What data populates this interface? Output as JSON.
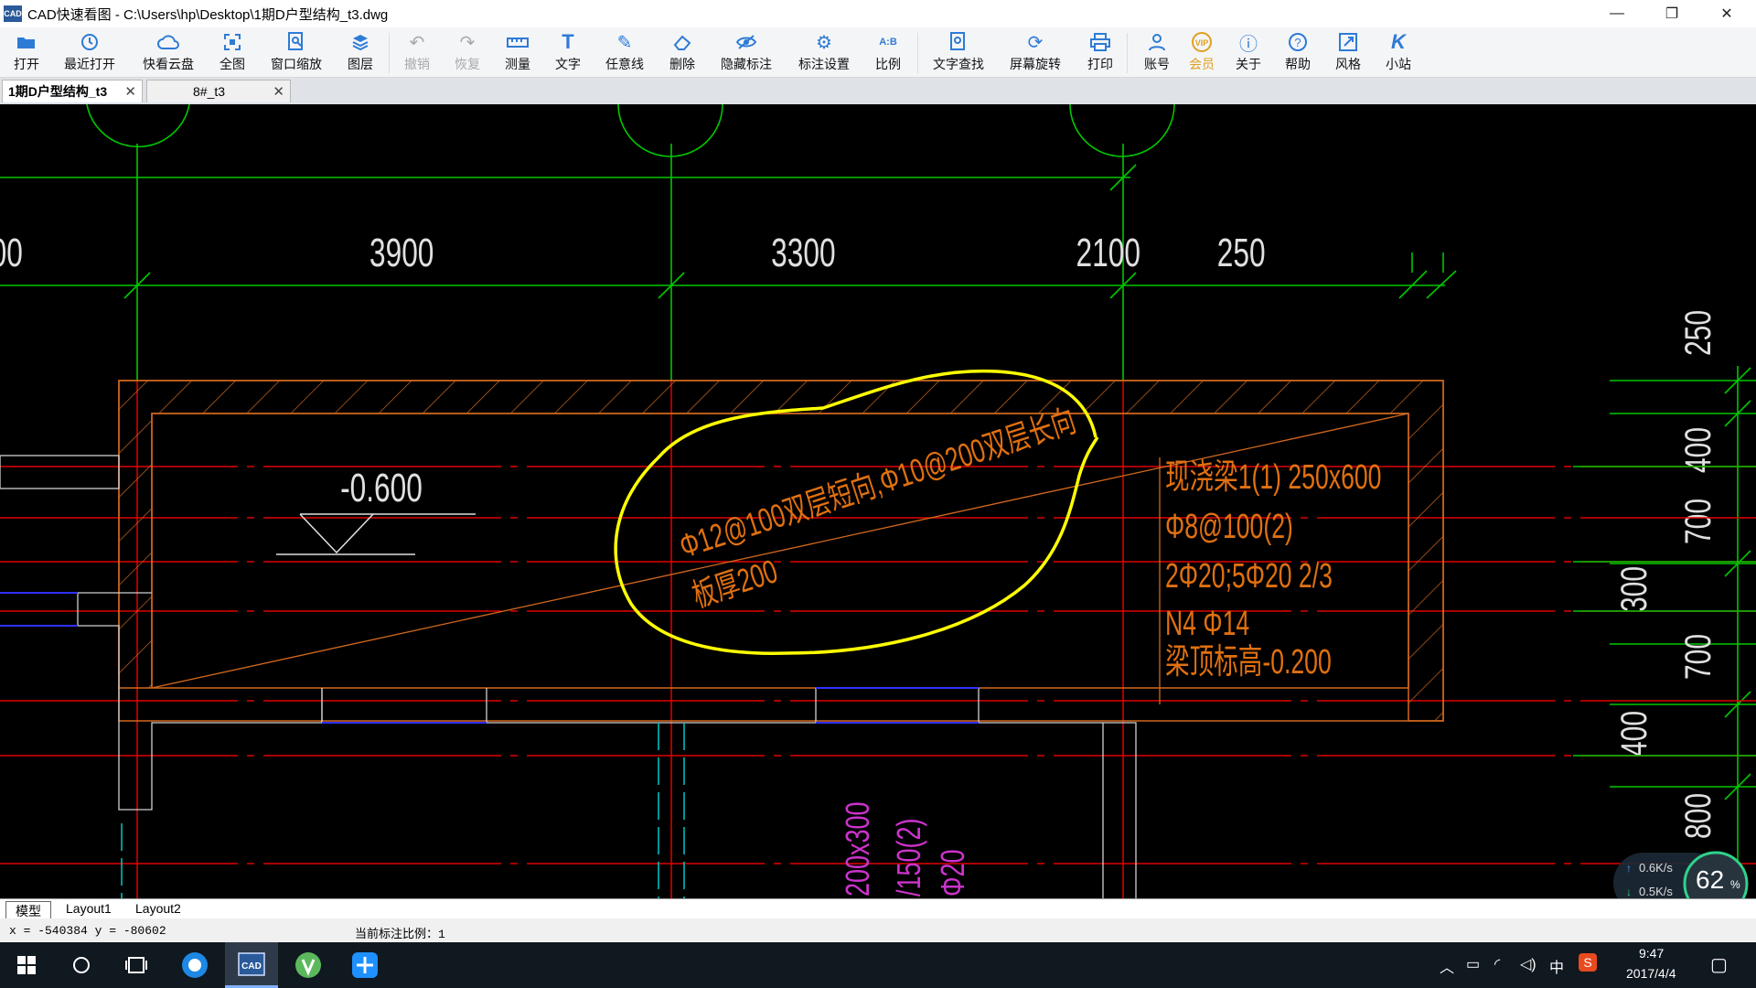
{
  "window": {
    "title": "CAD快速看图 - C:\\Users\\hp\\Desktop\\1期D户型结构_t3.dwg",
    "app_icon_text": "CAD",
    "minimize": "—",
    "maximize": "❐",
    "close": "✕"
  },
  "toolbar": {
    "items": [
      {
        "label": "打开",
        "icon": "folder-open-icon"
      },
      {
        "label": "最近打开",
        "icon": "clock-icon"
      },
      {
        "label": "快看云盘",
        "icon": "cloud-icon"
      },
      {
        "label": "全图",
        "icon": "fit-all-icon"
      },
      {
        "label": "窗口缩放",
        "icon": "zoom-window-icon"
      },
      {
        "label": "图层",
        "icon": "layers-icon"
      },
      {
        "label": "撤销",
        "icon": "undo-icon"
      },
      {
        "label": "恢复",
        "icon": "redo-icon"
      },
      {
        "label": "测量",
        "icon": "ruler-icon"
      },
      {
        "label": "文字",
        "icon": "text-icon"
      },
      {
        "label": "任意线",
        "icon": "pen-icon"
      },
      {
        "label": "删除",
        "icon": "eraser-icon"
      },
      {
        "label": "隐藏标注",
        "icon": "eye-hide-icon"
      },
      {
        "label": "标注设置",
        "icon": "dimension-settings-icon"
      },
      {
        "label": "比例",
        "icon": "scale-icon"
      },
      {
        "label": "文字查找",
        "icon": "text-search-icon"
      },
      {
        "label": "屏幕旋转",
        "icon": "rotate-screen-icon"
      },
      {
        "label": "打印",
        "icon": "printer-icon"
      },
      {
        "label": "账号",
        "icon": "user-icon"
      },
      {
        "label": "会员",
        "icon": "vip-icon"
      },
      {
        "label": "关于",
        "icon": "info-icon"
      },
      {
        "label": "帮助",
        "icon": "help-icon"
      },
      {
        "label": "风格",
        "icon": "style-icon"
      },
      {
        "label": "小站",
        "icon": "k-site-icon"
      }
    ]
  },
  "tabs": [
    {
      "label": "1期D户型结构_t3",
      "close": "✕"
    },
    {
      "label": "8#_t3",
      "close": "✕"
    }
  ],
  "drawing": {
    "dims_top": [
      "3900",
      "3300",
      "2100",
      "250"
    ],
    "dim_left_partial": "00",
    "dims_right": [
      "250",
      "400",
      "700",
      "300",
      "700",
      "400",
      "800"
    ],
    "elevation": "-0.600",
    "slab_note_1": "Φ12@100双层短向,Φ10@200双层长向",
    "slab_note_2": "板厚200",
    "beam_notes": [
      "现浇梁1(1) 250x600",
      "Φ8@100(2)",
      "2Φ20;5Φ20 2/3",
      "N4 Φ14",
      "梁顶标高-0.200"
    ],
    "magenta_texts": [
      "200x300",
      "/150(2)",
      "Φ20"
    ]
  },
  "layout_tabs": [
    "模型",
    "Layout1",
    "Layout2"
  ],
  "status": {
    "coords": "x = -540384  y = -80602",
    "scale": "当前标注比例：1"
  },
  "net_widget": {
    "up": "0.6K/s",
    "down": "0.5K/s",
    "percent": "62",
    "percent_unit": "%"
  },
  "taskbar": {
    "ime": "中",
    "time": "9:47",
    "date": "2017/4/4"
  },
  "colors": {
    "grid_green": "#00c800",
    "red_axis": "#e00000",
    "orange_wall": "#d2691e",
    "yellow_mark": "#ffff00",
    "dim_text": "#e0e0e0",
    "magenta": "#cc33cc"
  }
}
